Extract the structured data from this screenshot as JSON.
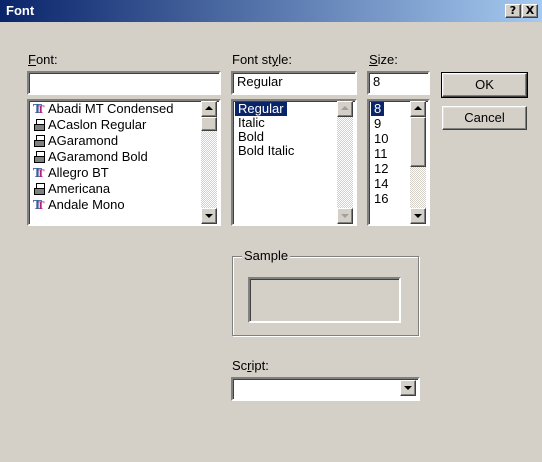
{
  "window": {
    "title": "Font",
    "help_glyph": "?",
    "close_glyph": "X"
  },
  "font": {
    "label_u": "F",
    "label_rest": "ont:",
    "value": "",
    "items": [
      {
        "name": "Abadi MT Condensed",
        "icon": "truetype-icon"
      },
      {
        "name": "ACaslon Regular",
        "icon": "printer-font-icon"
      },
      {
        "name": "AGaramond",
        "icon": "printer-font-icon"
      },
      {
        "name": "AGaramond Bold",
        "icon": "printer-font-icon"
      },
      {
        "name": "Allegro BT",
        "icon": "truetype-icon"
      },
      {
        "name": "Americana",
        "icon": "printer-font-icon"
      },
      {
        "name": "Andale Mono",
        "icon": "truetype-icon"
      }
    ]
  },
  "style": {
    "label_pre": "Font st",
    "label_u": "y",
    "label_rest": "le:",
    "value": "Regular",
    "items": [
      "Regular",
      "Italic",
      "Bold",
      "Bold Italic"
    ],
    "selected": "Regular"
  },
  "size": {
    "label_u": "S",
    "label_rest": "ize:",
    "value": "8",
    "items": [
      "8",
      "9",
      "10",
      "11",
      "12",
      "14",
      "16"
    ],
    "selected": "8"
  },
  "buttons": {
    "ok": "OK",
    "cancel": "Cancel"
  },
  "sample": {
    "label": "Sample"
  },
  "script": {
    "label_pre": "Sc",
    "label_u": "r",
    "label_rest": "ipt:",
    "value": ""
  }
}
